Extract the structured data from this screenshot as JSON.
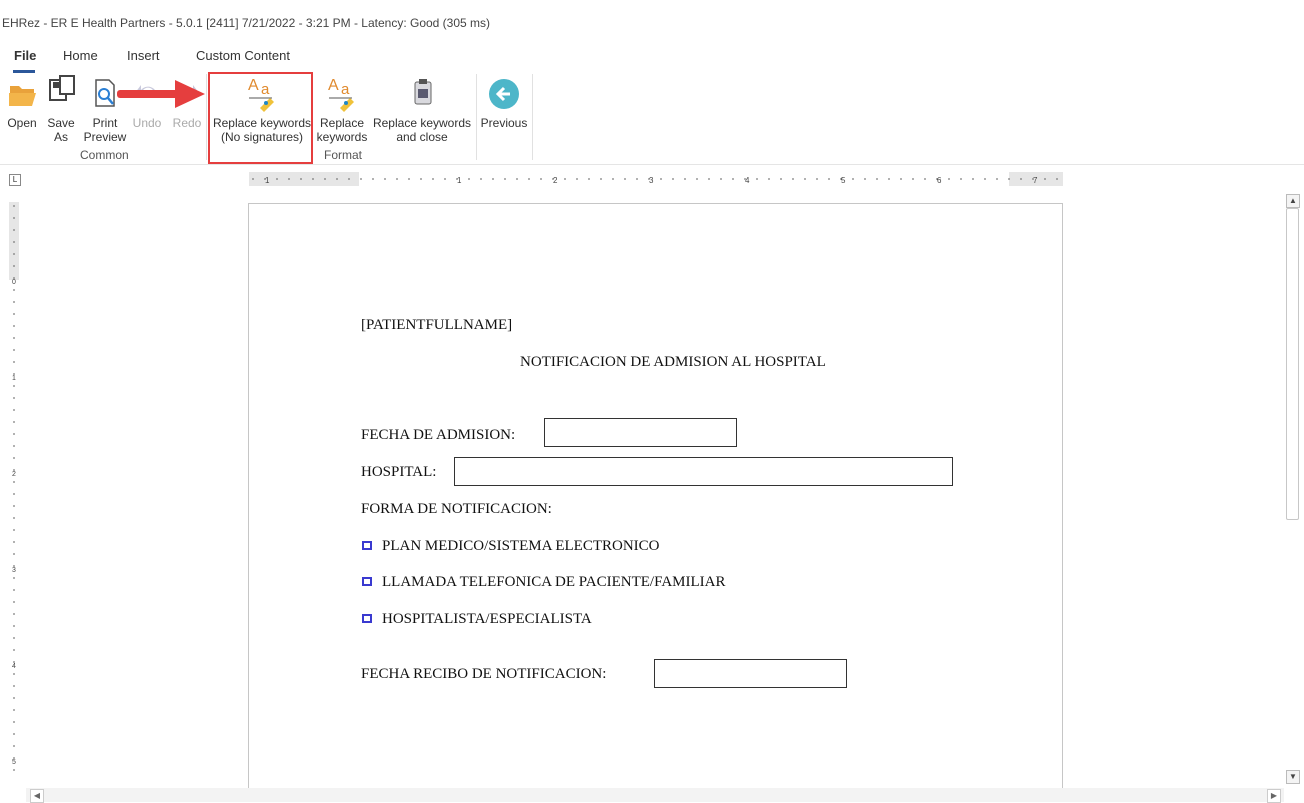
{
  "window": {
    "title": "EHRez - ER E Health Partners - 5.0.1 [2411] 7/21/2022 - 3:21 PM - Latency: Good (305 ms)"
  },
  "tabs": [
    "File",
    "Home",
    "Insert",
    "Custom Content"
  ],
  "ribbon": {
    "open": "Open",
    "save_as": [
      "Save",
      "As"
    ],
    "print_preview": [
      "Print",
      "Preview"
    ],
    "undo": "Undo",
    "redo": "Redo",
    "group_common": "Common",
    "replace_no_sig": [
      "Replace keywords",
      "(No signatures)"
    ],
    "replace": [
      "Replace",
      "keywords"
    ],
    "group_format": "Format",
    "replace_close": [
      "Replace keywords",
      "and close"
    ],
    "previous": "Previous"
  },
  "ruler": {
    "h_labels": [
      "1",
      "1",
      "2",
      "3",
      "4",
      "5",
      "6",
      "7"
    ],
    "v_labels": [
      "0",
      "1",
      "2",
      "3",
      "4",
      "5"
    ]
  },
  "document": {
    "patient": "[PATIENTFULLNAME]",
    "heading": "NOTIFICACION DE ADMISION AL HOSPITAL",
    "fecha_label": "FECHA DE ADMISION:",
    "hospital_label": "HOSPITAL:",
    "forma_label": "FORMA DE NOTIFICACION:",
    "options": [
      "PLAN MEDICO/SISTEMA ELECTRONICO",
      "LLAMADA TELEFONICA DE PACIENTE/FAMILIAR",
      "HOSPITALISTA/ESPECIALISTA"
    ],
    "recibo_label": "FECHA RECIBO DE NOTIFICACION:"
  },
  "colors": {
    "accent": "#2b579a",
    "highlight": "#e53e3e",
    "checkbox": "#3a3ad0",
    "previous_icon": "#4db6c9"
  }
}
